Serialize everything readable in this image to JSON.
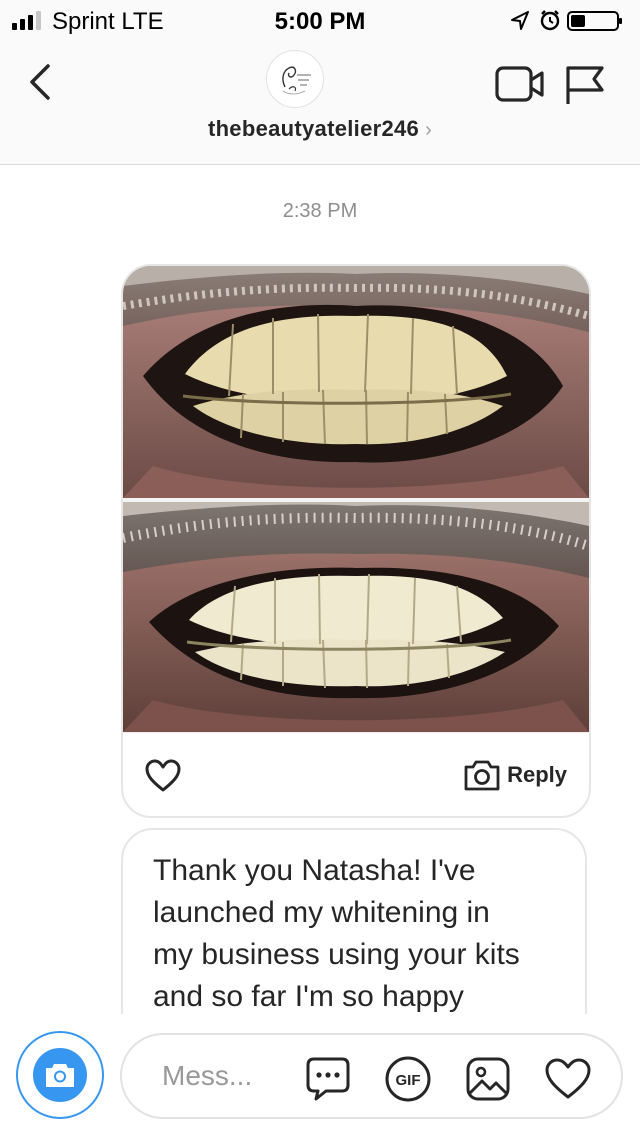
{
  "status_bar": {
    "carrier": "Sprint  LTE",
    "time": "5:00 PM",
    "signal_bars": 4,
    "signal_filled": 3,
    "icons": [
      "location-arrow-icon",
      "alarm-icon",
      "battery-icon"
    ],
    "battery_level": 0.3
  },
  "header": {
    "username": "thebeautyatelier246",
    "chevron": "›",
    "avatar_logo_text": "The Beauty Atelier",
    "icons": [
      "back-chevron-icon",
      "video-call-icon",
      "flag-icon"
    ]
  },
  "chat": {
    "timestamp": "2:38 PM",
    "photo_message": {
      "reply_label": "Reply",
      "images": [
        "before-teeth-photo",
        "after-teeth-photo"
      ]
    },
    "text_message": {
      "lines": [
        "Thank you Natasha! I've",
        "launched my whitening in",
        "my business using your kits",
        "and so far I'm so happy"
      ]
    }
  },
  "composer": {
    "placeholder": "Mess...",
    "gif_label": "GIF",
    "icons": [
      "camera-icon",
      "sticker-chat-icon",
      "gif-icon",
      "gallery-icon",
      "heart-icon"
    ]
  },
  "colors": {
    "accent": "#3797f0",
    "text": "#262626",
    "muted": "#8e8e8e",
    "border": "#dbdbdb"
  }
}
